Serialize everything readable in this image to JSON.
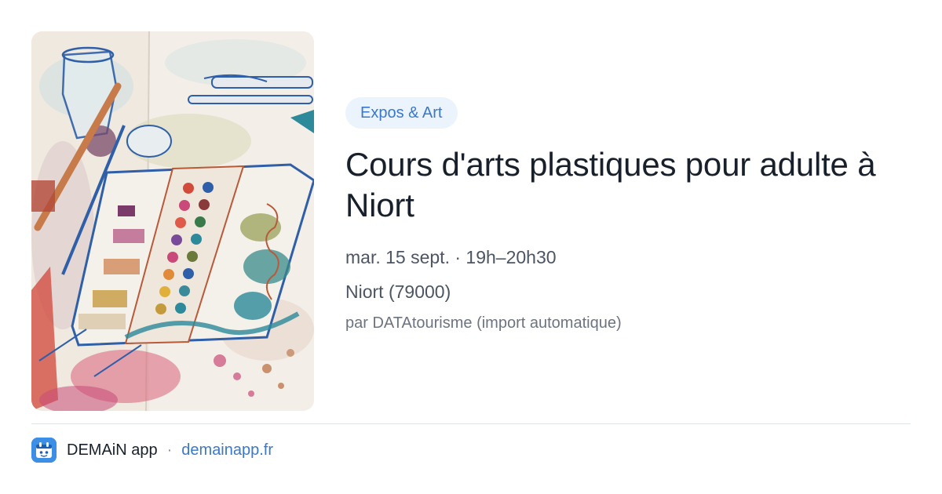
{
  "event": {
    "category": "Expos & Art",
    "title": "Cours d'arts plastiques pour adulte à Niort",
    "datetime": "mar. 15 sept. · 19h–20h30",
    "location": "Niort (79000)",
    "source": "par DATAtourisme (import automatique)"
  },
  "image": {
    "subject": "watercolor-sketch-paint-palette",
    "colors": {
      "paper": "#f1ede6",
      "blue_ink": "#2f5fa8",
      "teal": "#2c8a9a",
      "red": "#d2443a",
      "pink": "#c94a78",
      "ochre": "#c39a3c"
    }
  },
  "footer": {
    "app_name": "DEMAiN app",
    "separator": "·",
    "link_text": "demainapp.fr",
    "icon": "demain-app-icon"
  },
  "theme": {
    "accent": "#3a78c9",
    "badge_bg": "#ebf3fd",
    "title_color": "#18202c",
    "text_color": "#4d5563",
    "muted_color": "#6d7480",
    "divider": "#dde3e9"
  }
}
